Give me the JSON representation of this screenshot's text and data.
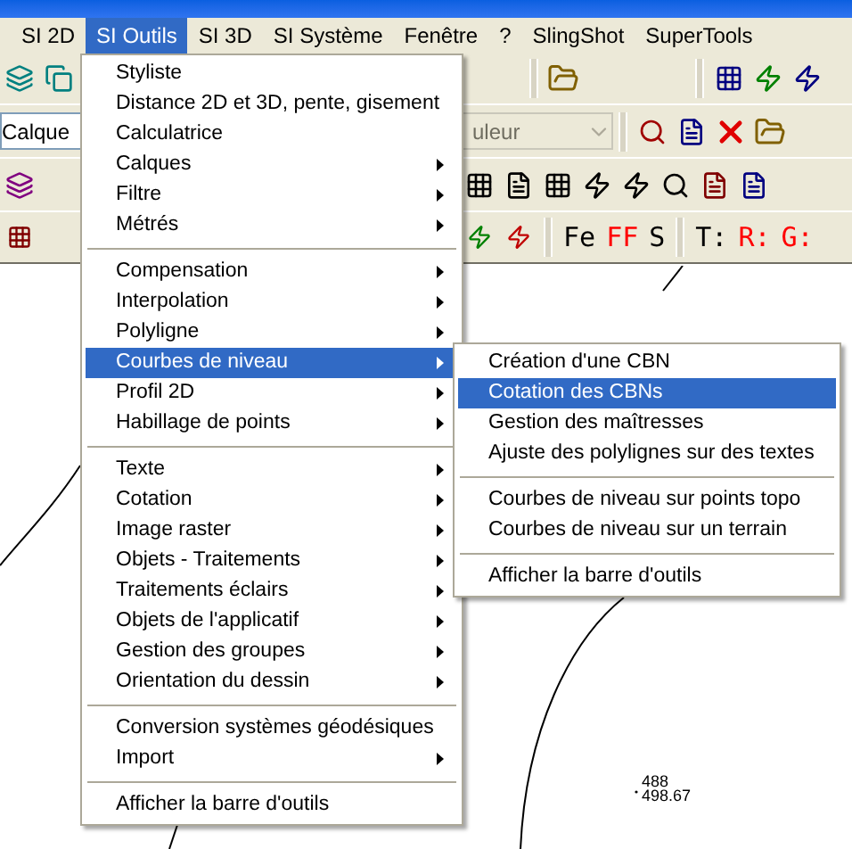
{
  "menubar": [
    {
      "label": "SI 2D",
      "selected": false
    },
    {
      "label": "SI Outils",
      "selected": true
    },
    {
      "label": "SI 3D",
      "selected": false
    },
    {
      "label": "SI Système",
      "selected": false
    },
    {
      "label": "Fenêtre",
      "selected": false
    },
    {
      "label": "?",
      "selected": false
    },
    {
      "label": "SlingShot",
      "selected": false
    },
    {
      "label": "SuperTools",
      "selected": false
    }
  ],
  "toolbar": {
    "layer_field": {
      "value": "Calque"
    },
    "color_field": {
      "value": "uleur",
      "disabled": true
    },
    "text_buttons": [
      {
        "label": "Fe",
        "color": "#000000"
      },
      {
        "label": "FF",
        "color": "#ff0000"
      },
      {
        "label": "S",
        "color": "#000000"
      },
      {
        "label": "T:",
        "color": "#000000"
      },
      {
        "label": "R:",
        "color": "#ff0000"
      },
      {
        "label": "G:",
        "color": "#ff0000"
      }
    ]
  },
  "menu": {
    "items": [
      {
        "kind": "item",
        "label": "Styliste",
        "submenu": false,
        "selected": false
      },
      {
        "kind": "item",
        "label": "Distance 2D et 3D, pente, gisement",
        "submenu": false,
        "selected": false
      },
      {
        "kind": "item",
        "label": "Calculatrice",
        "submenu": false,
        "selected": false
      },
      {
        "kind": "item",
        "label": "Calques",
        "submenu": true,
        "selected": false
      },
      {
        "kind": "item",
        "label": "Filtre",
        "submenu": true,
        "selected": false
      },
      {
        "kind": "item",
        "label": "Métrés",
        "submenu": true,
        "selected": false
      },
      {
        "kind": "separator"
      },
      {
        "kind": "item",
        "label": "Compensation",
        "submenu": true,
        "selected": false
      },
      {
        "kind": "item",
        "label": "Interpolation",
        "submenu": true,
        "selected": false
      },
      {
        "kind": "item",
        "label": "Polyligne",
        "submenu": true,
        "selected": false
      },
      {
        "kind": "item",
        "label": "Courbes de niveau",
        "submenu": true,
        "selected": true
      },
      {
        "kind": "item",
        "label": "Profil 2D",
        "submenu": true,
        "selected": false
      },
      {
        "kind": "item",
        "label": "Habillage de points",
        "submenu": true,
        "selected": false
      },
      {
        "kind": "separator"
      },
      {
        "kind": "item",
        "label": "Texte",
        "submenu": true,
        "selected": false
      },
      {
        "kind": "item",
        "label": "Cotation",
        "submenu": true,
        "selected": false
      },
      {
        "kind": "item",
        "label": "Image raster",
        "submenu": true,
        "selected": false
      },
      {
        "kind": "item",
        "label": "Objets - Traitements",
        "submenu": true,
        "selected": false
      },
      {
        "kind": "item",
        "label": "Traitements éclairs",
        "submenu": true,
        "selected": false
      },
      {
        "kind": "item",
        "label": "Objets de l'applicatif",
        "submenu": true,
        "selected": false
      },
      {
        "kind": "item",
        "label": "Gestion des groupes",
        "submenu": true,
        "selected": false
      },
      {
        "kind": "item",
        "label": "Orientation du dessin",
        "submenu": true,
        "selected": false
      },
      {
        "kind": "separator"
      },
      {
        "kind": "item",
        "label": "Conversion systèmes géodésiques",
        "submenu": false,
        "selected": false
      },
      {
        "kind": "item",
        "label": "Import",
        "submenu": true,
        "selected": false
      },
      {
        "kind": "separator"
      },
      {
        "kind": "item",
        "label": "Afficher la barre d'outils",
        "submenu": false,
        "selected": false
      }
    ]
  },
  "submenu": {
    "items": [
      {
        "kind": "item",
        "label": "Création d'une CBN",
        "submenu": false,
        "selected": false
      },
      {
        "kind": "item",
        "label": "Cotation des CBNs",
        "submenu": false,
        "selected": true
      },
      {
        "kind": "item",
        "label": "Gestion des maîtresses",
        "submenu": false,
        "selected": false
      },
      {
        "kind": "item",
        "label": "Ajuste des polylignes sur des textes",
        "submenu": false,
        "selected": false
      },
      {
        "kind": "separator"
      },
      {
        "kind": "item",
        "label": "Courbes de niveau sur points topo",
        "submenu": false,
        "selected": false
      },
      {
        "kind": "item",
        "label": "Courbes de niveau sur un terrain",
        "submenu": false,
        "selected": false
      },
      {
        "kind": "separator"
      },
      {
        "kind": "item",
        "label": "Afficher la barre d'outils",
        "submenu": false,
        "selected": false
      }
    ]
  },
  "canvas": {
    "labels": [
      "488",
      "498.67"
    ]
  }
}
